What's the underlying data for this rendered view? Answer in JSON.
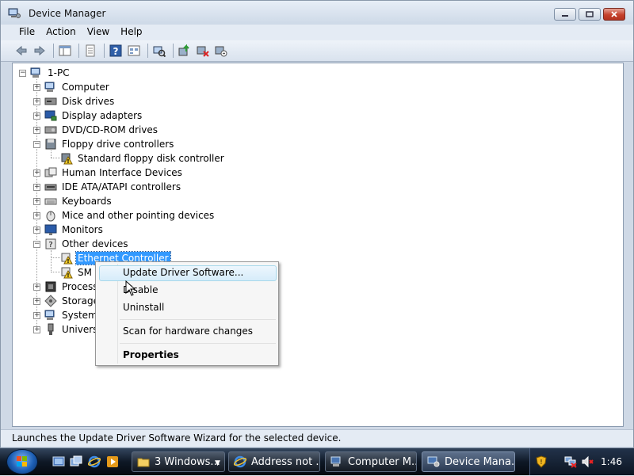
{
  "window": {
    "title": "Device Manager",
    "menu": [
      "File",
      "Action",
      "View",
      "Help"
    ]
  },
  "toolbar": {
    "icons": [
      "back-arrow-icon",
      "forward-arrow-icon",
      "console-tree-icon",
      "properties-icon",
      "help-icon",
      "view-icon",
      "scan-hardware-icon",
      "update-driver-icon",
      "disable-device-icon",
      "uninstall-device-icon"
    ]
  },
  "tree": {
    "root": "1-PC",
    "items": [
      {
        "label": "Computer"
      },
      {
        "label": "Disk drives"
      },
      {
        "label": "Display adapters"
      },
      {
        "label": "DVD/CD-ROM drives"
      },
      {
        "label": "Floppy drive controllers"
      },
      {
        "label": "Standard floppy disk controller"
      },
      {
        "label": "Human Interface Devices"
      },
      {
        "label": "IDE ATA/ATAPI controllers"
      },
      {
        "label": "Keyboards"
      },
      {
        "label": "Mice and other pointing devices"
      },
      {
        "label": "Monitors"
      },
      {
        "label": "Other devices"
      },
      {
        "label": "Ethernet Controller"
      },
      {
        "label": "SM B"
      },
      {
        "label": "Processo"
      },
      {
        "label": "Storage"
      },
      {
        "label": "System"
      },
      {
        "label": "Universa"
      }
    ]
  },
  "context_menu": {
    "items": [
      "Update Driver Software...",
      "Disable",
      "Uninstall",
      "Scan for hardware changes",
      "Properties"
    ]
  },
  "status_bar": {
    "text": "Launches the Update Driver Software Wizard for the selected device."
  },
  "taskbar": {
    "tasks": [
      "3 Windows...",
      "Address not ...",
      "Computer M...",
      "Device Mana..."
    ],
    "clock": "1:46"
  }
}
